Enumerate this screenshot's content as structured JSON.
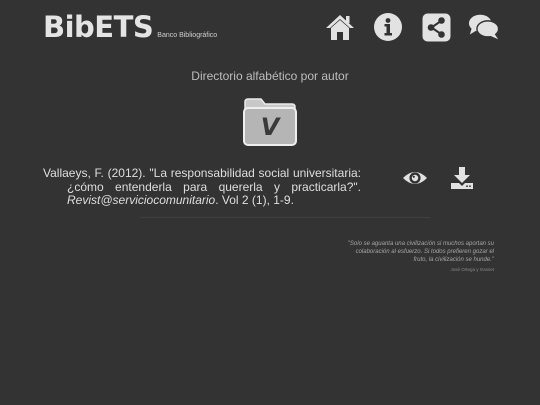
{
  "brand": {
    "name": "BibETS",
    "tagline": "Banco Bibliográfico"
  },
  "nav": [
    {
      "name": "home-icon"
    },
    {
      "name": "info-icon"
    },
    {
      "name": "share-icon"
    },
    {
      "name": "chat-icon"
    }
  ],
  "page": {
    "heading": "Directorio alfabético por autor",
    "folder_letter": "V"
  },
  "entry": {
    "prefix": "Vallaeys, F. (2012). \"La responsabilidad social universitaria: ¿cómo entenderla para quererla y practicarla?\". ",
    "journal": "Revist@serviciocomunitario",
    "suffix": ". Vol 2 (1), 1-9."
  },
  "actions": {
    "view_icon": "eye-icon",
    "download_icon": "download-icon"
  },
  "quote": {
    "text": "\"Solo se aguanta una civilización si muchos aportan su colaboración al esfuerzo. Si todos prefieren gozar el fruto, la civilización se hunde.\"",
    "author": "José Ortega y Gasset"
  },
  "colors": {
    "background": "#333333",
    "icon": "#e2e2e2",
    "text": "#dedede"
  }
}
